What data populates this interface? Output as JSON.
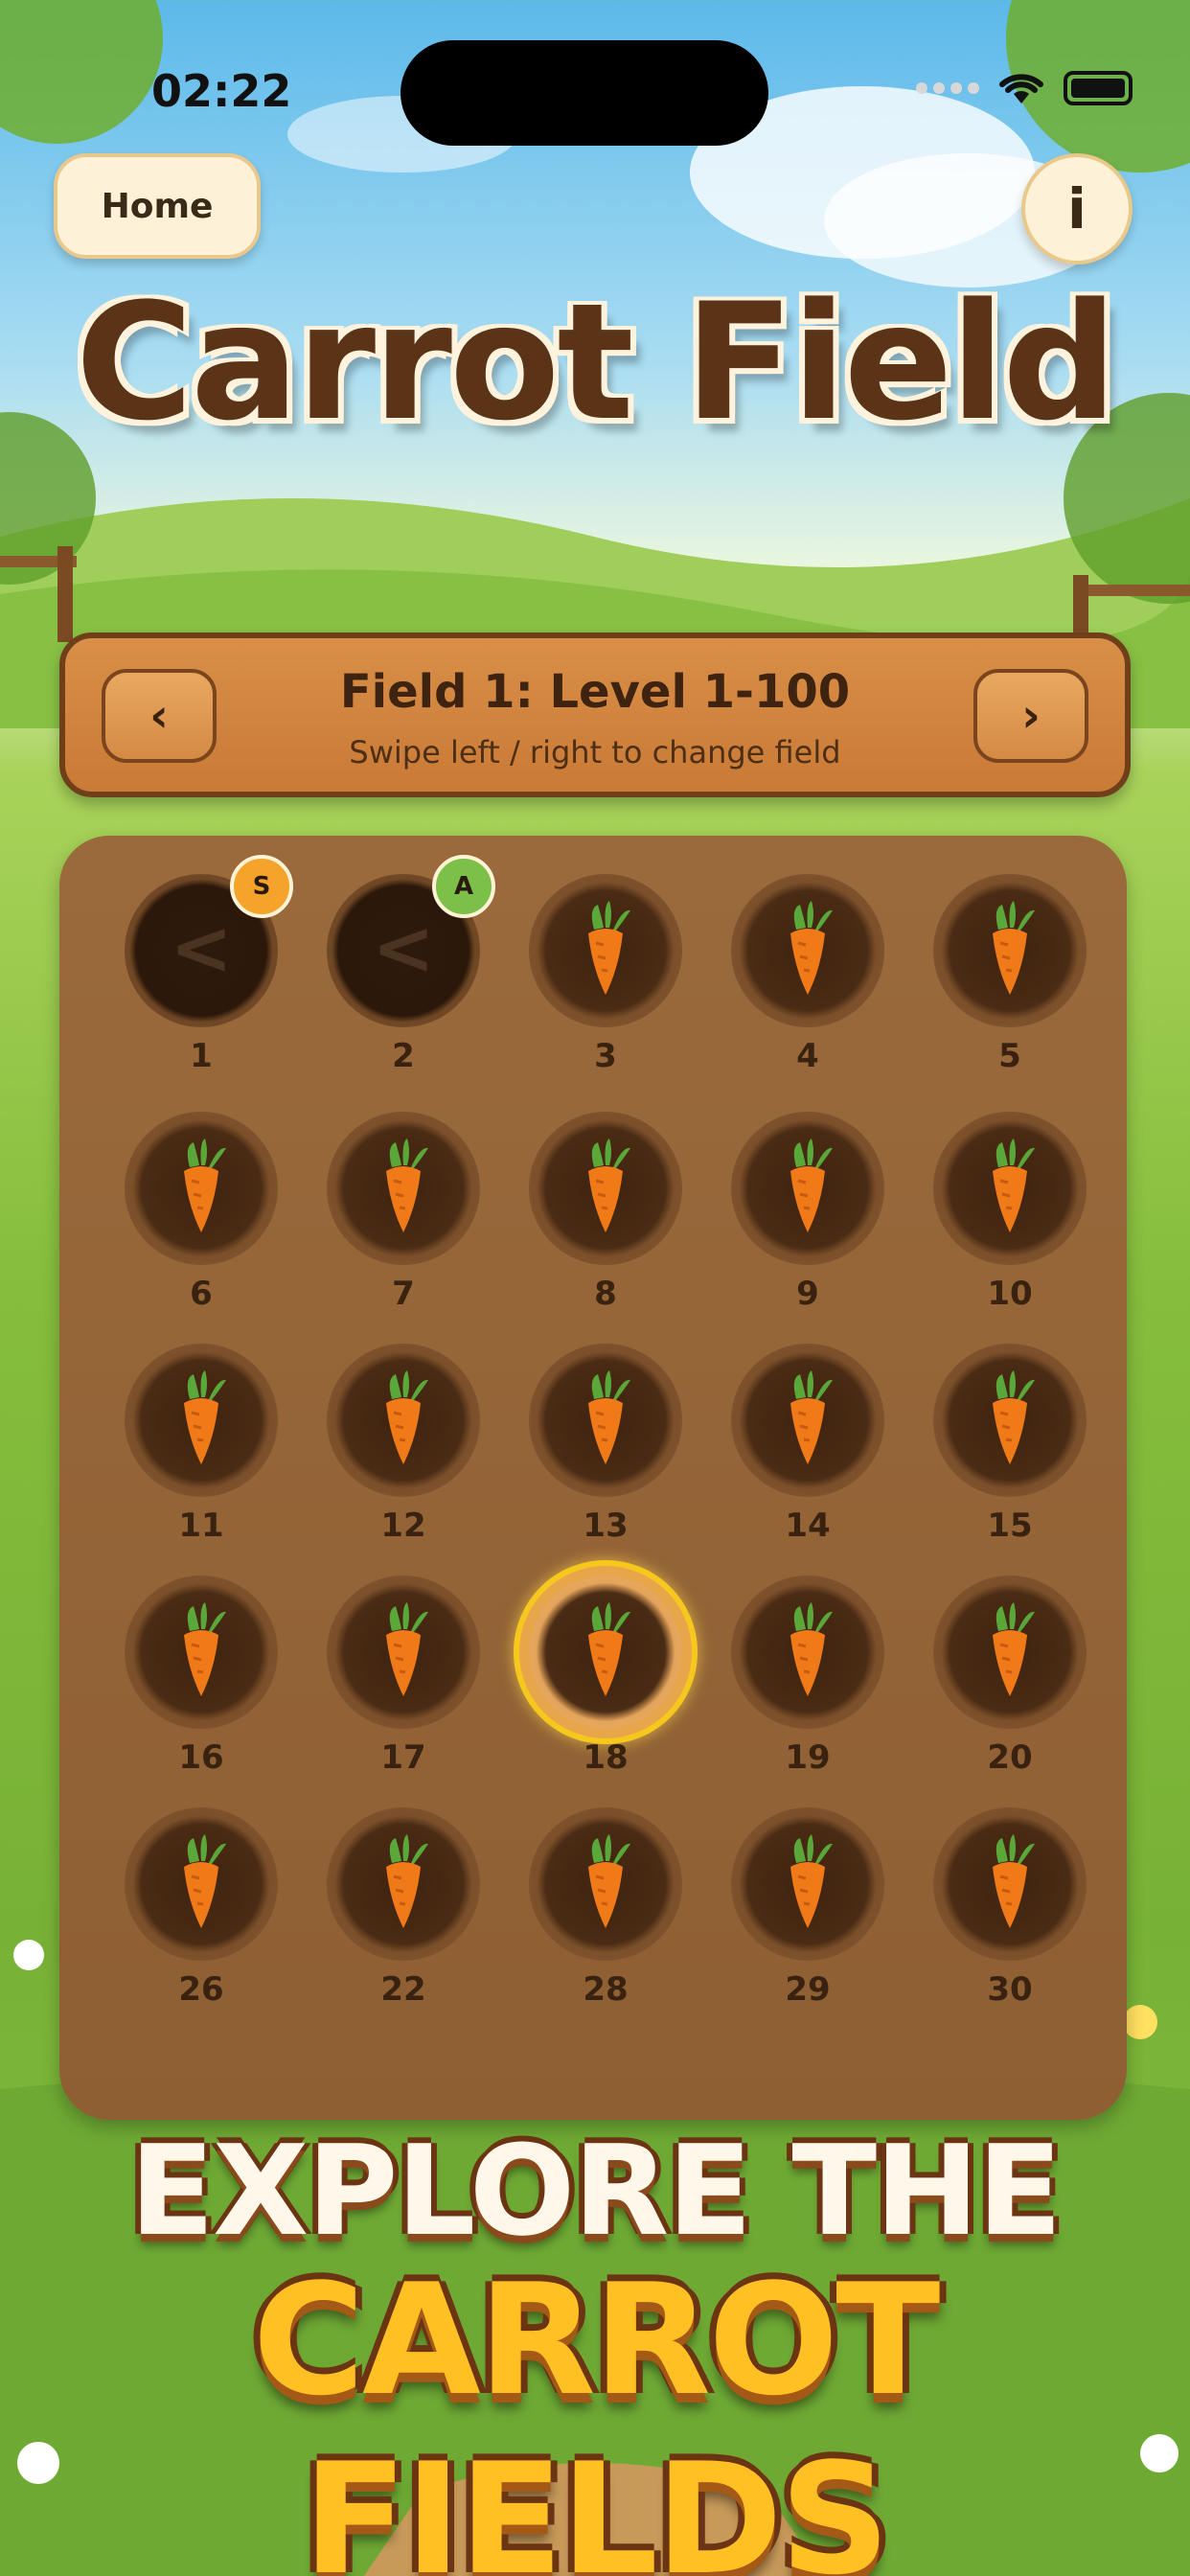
{
  "status_bar": {
    "time": "02:22"
  },
  "nav": {
    "home_label": "Home",
    "info_label": "i"
  },
  "title": "Carrot Field",
  "field": {
    "title": "Field 1: Level 1-100",
    "hint": "Swipe left / right to change field",
    "prev_label": "‹",
    "next_label": "›"
  },
  "levels": [
    {
      "number": "1",
      "state": "locked",
      "badge": "S",
      "badge_color": "#f5a32a"
    },
    {
      "number": "2",
      "state": "locked",
      "badge": "A",
      "badge_color": "#7cc04a"
    },
    {
      "number": "3",
      "state": "available"
    },
    {
      "number": "4",
      "state": "available"
    },
    {
      "number": "5",
      "state": "available"
    },
    {
      "number": "6",
      "state": "available"
    },
    {
      "number": "7",
      "state": "available"
    },
    {
      "number": "8",
      "state": "available"
    },
    {
      "number": "9",
      "state": "available"
    },
    {
      "number": "10",
      "state": "available"
    },
    {
      "number": "11",
      "state": "available"
    },
    {
      "number": "12",
      "state": "available"
    },
    {
      "number": "13",
      "state": "available"
    },
    {
      "number": "14",
      "state": "available"
    },
    {
      "number": "15",
      "state": "available"
    },
    {
      "number": "16",
      "state": "available"
    },
    {
      "number": "17",
      "state": "available"
    },
    {
      "number": "18",
      "state": "selected"
    },
    {
      "number": "19",
      "state": "available"
    },
    {
      "number": "20",
      "state": "available"
    },
    {
      "number": "26",
      "state": "available"
    },
    {
      "number": "22",
      "state": "available"
    },
    {
      "number": "28",
      "state": "available"
    },
    {
      "number": "29",
      "state": "available"
    },
    {
      "number": "30",
      "state": "available"
    }
  ],
  "promo": {
    "line1": "EXPLORE THE",
    "line2": "CARROT FIELDS"
  },
  "colors": {
    "board": "#9a6a3c",
    "banner": "#d98f48",
    "carrot": "#f07a18",
    "leaf": "#5aa83a",
    "selected_ring": "#f6c81d"
  }
}
